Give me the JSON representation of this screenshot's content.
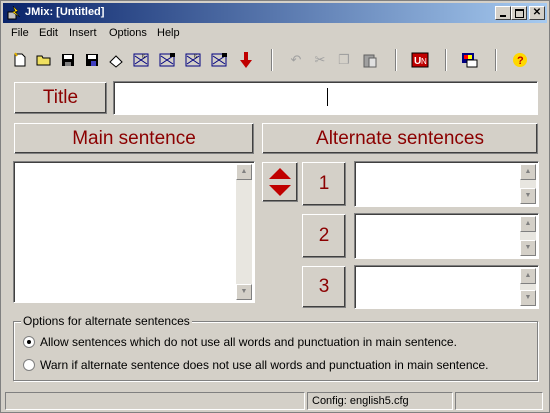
{
  "window": {
    "title": "JMix: [Untitled]"
  },
  "menu": [
    "File",
    "Edit",
    "Insert",
    "Options",
    "Help"
  ],
  "toolbar": {
    "icons": [
      "new-file-icon",
      "open-folder-icon",
      "save-icon",
      "save-as-icon",
      "eraser-icon",
      "web-export-1-icon",
      "web-export-2-icon",
      "web-export-3-icon",
      "web-export-4-icon",
      "down-arrow-icon",
      "undo-icon",
      "cut-icon",
      "copy-icon",
      "paste-icon",
      "unicode-icon",
      "palette-icon",
      "help-icon"
    ]
  },
  "title_section": {
    "label": "Title",
    "value": ""
  },
  "main": {
    "heading": "Main sentence",
    "value": ""
  },
  "alternates": {
    "heading": "Alternate sentences",
    "items": [
      "1",
      "2",
      "3"
    ]
  },
  "options": {
    "legend": "Options for alternate sentences",
    "option1": "Allow sentences which do not use all words and punctuation in main sentence.",
    "option2": "Warn if alternate sentence does not use all words and punctuation in main sentence.",
    "selected": 1
  },
  "status": {
    "config": "Config: english5.cfg"
  },
  "colors": {
    "accent": "#8b0000",
    "titlebar": "#0a246a"
  }
}
